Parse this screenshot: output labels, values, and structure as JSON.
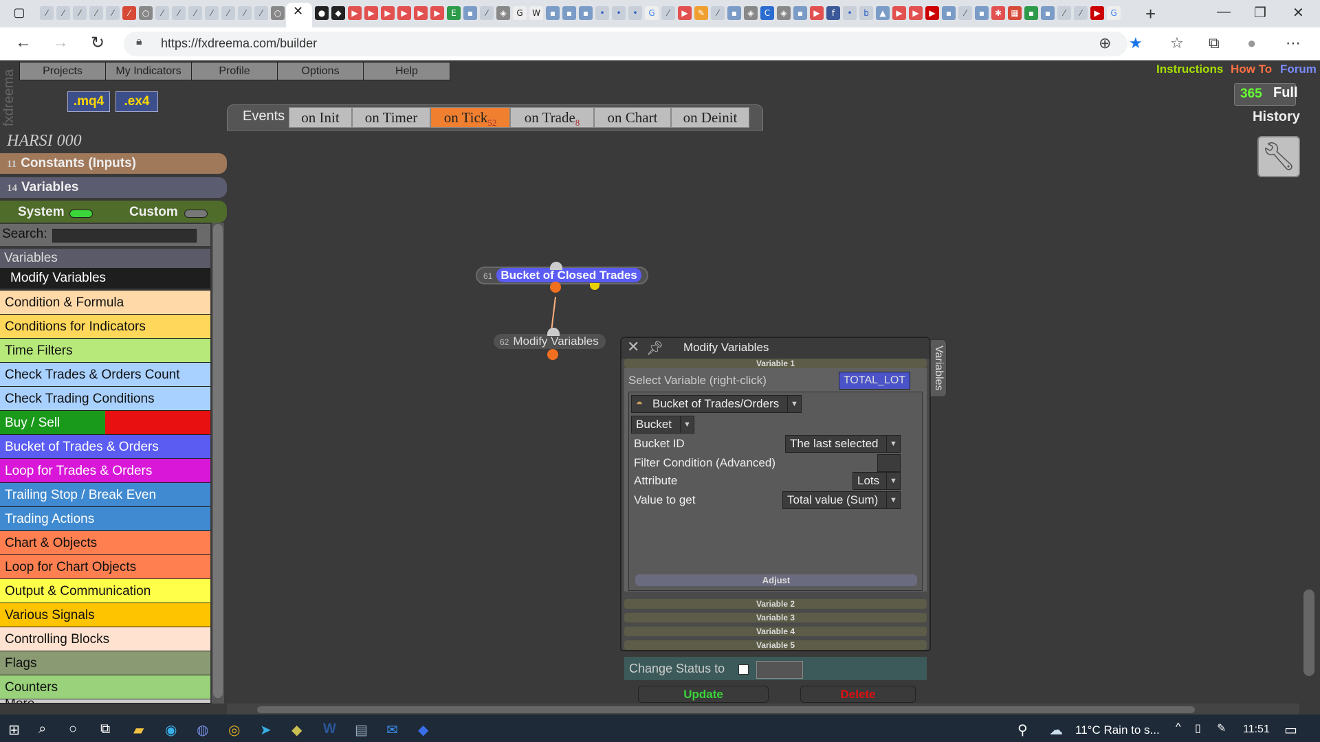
{
  "browser": {
    "url": "https://fxdreema.com/builder",
    "active_tab_close": "✕",
    "new_tab": "+",
    "win_min": "—",
    "win_max": "❐",
    "win_close": "✕"
  },
  "menu": {
    "logo": "fxdreema",
    "items": [
      "Projects",
      "My Indicators",
      "Profile",
      "Options",
      "Help"
    ],
    "file_btns": [
      ".mq4",
      ".ex4"
    ],
    "links": {
      "instructions": "Instructions",
      "howto": "How To",
      "forum": "Forum"
    },
    "instructions_color": "#a8e000",
    "howto_color": "#ff7043",
    "forum_color": "#7a8cff",
    "days": "365",
    "full": "Full",
    "history": "History"
  },
  "events": {
    "label": "Events",
    "tabs": [
      {
        "name": "on Init",
        "count": ""
      },
      {
        "name": "on Timer",
        "count": ""
      },
      {
        "name": "on Tick",
        "count": "52"
      },
      {
        "name": "on Trade",
        "count": "8"
      },
      {
        "name": "on Chart",
        "count": ""
      },
      {
        "name": "on Deinit",
        "count": ""
      }
    ],
    "active": "on Tick"
  },
  "sidebar": {
    "project_name": "HARSI 000",
    "constants": {
      "count": "11",
      "label": "Constants (Inputs)"
    },
    "variables": {
      "count": "14",
      "label": "Variables"
    },
    "system_label": "System",
    "custom_label": "Custom",
    "system_on": true,
    "custom_on": false,
    "search_label": "Search:",
    "search_value": "",
    "section_header": "Variables",
    "selected_item": "Modify Variables",
    "categories": [
      {
        "label": "Condition & Formula",
        "bg": "#ffd9a8"
      },
      {
        "label": "Conditions for Indicators",
        "bg": "#ffd75a"
      },
      {
        "label": "Time Filters",
        "bg": "#b6e87a"
      },
      {
        "label": "Check Trades & Orders Count",
        "bg": "#a9d1ff"
      },
      {
        "label": "Check Trading Conditions",
        "bg": "#a9d1ff"
      },
      {
        "label": "Buy / Sell",
        "bg": "#1a9a1a"
      },
      {
        "label": "Bucket of Trades & Orders",
        "bg": "#5a5cf2"
      },
      {
        "label": "Loop for Trades & Orders",
        "bg": "#d817d8"
      },
      {
        "label": "Trailing Stop / Break Even",
        "bg": "#3f8ad0"
      },
      {
        "label": "Trading Actions",
        "bg": "#3f8ad0"
      },
      {
        "label": "Chart & Objects",
        "bg": "#ff7f50"
      },
      {
        "label": "Loop for Chart Objects",
        "bg": "#ff7f50"
      },
      {
        "label": "Output & Communication",
        "bg": "#ffff4a"
      },
      {
        "label": "Various Signals",
        "bg": "#ffc400"
      },
      {
        "label": "Controlling Blocks",
        "bg": "#ffe2cf"
      },
      {
        "label": "Flags",
        "bg": "#8a9a72"
      },
      {
        "label": "Counters",
        "bg": "#99d27a"
      },
      {
        "label": "More",
        "bg": "#cfcfcf"
      }
    ]
  },
  "canvas": {
    "node1": {
      "id": "61",
      "label": "Bucket of Closed Trades"
    },
    "node2": {
      "id": "62",
      "label": "Modify Variables"
    }
  },
  "dialog": {
    "title": "Modify Variables",
    "side_tab": "Variables",
    "var_tabs": [
      "Variable 1",
      "Variable 2",
      "Variable 3",
      "Variable 4",
      "Variable 5"
    ],
    "select_label": "Select Variable (right-click)",
    "selected_var": "TOTAL_LOT",
    "source": "Bucket of Trades/Orders",
    "source_sub": "Bucket",
    "params": [
      {
        "label": "Bucket ID",
        "value": "The last selected"
      },
      {
        "label": "Filter Condition (Advanced)",
        "value": ""
      },
      {
        "label": "Attribute",
        "value": "Lots"
      },
      {
        "label": "Value to get",
        "value": "Total value (Sum)"
      }
    ],
    "adjust": "Adjust",
    "status_label": "Change Status to",
    "status_checked": false,
    "update": "Update",
    "delete": "Delete"
  },
  "taskbar": {
    "weather": "11°C  Rain to s...",
    "time": "11:51"
  }
}
